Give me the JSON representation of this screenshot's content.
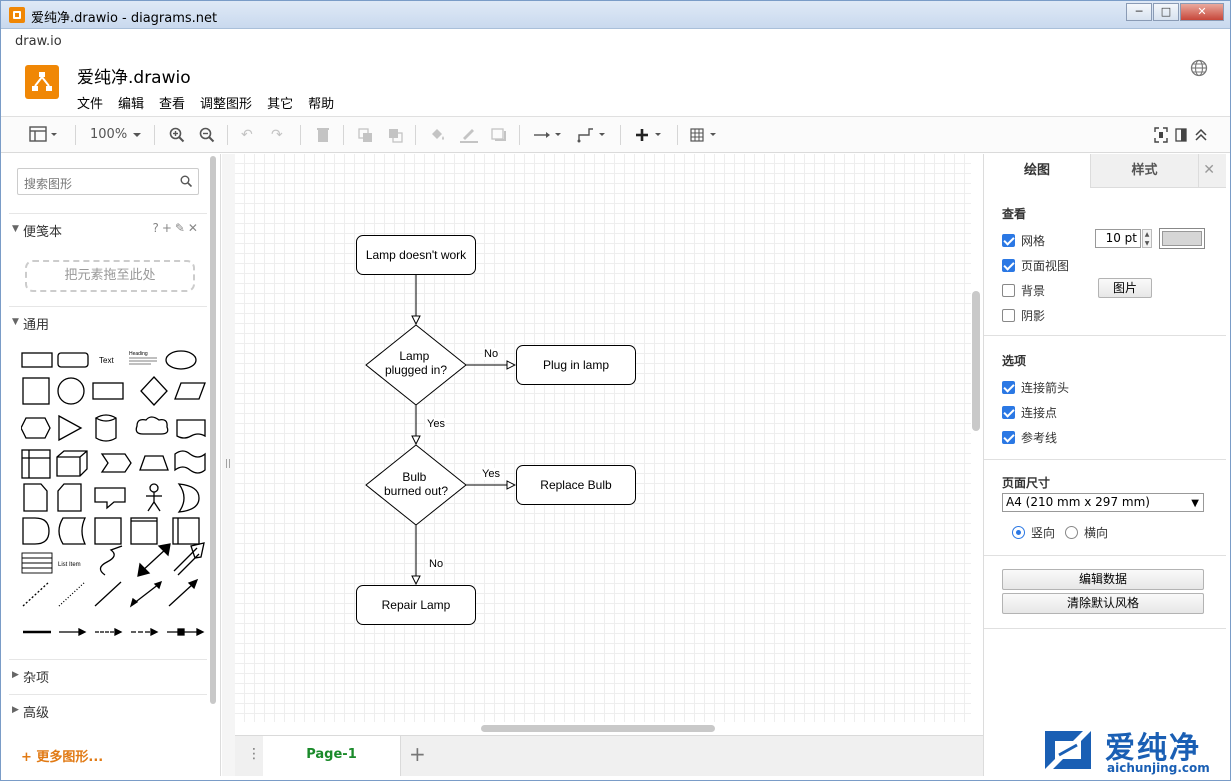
{
  "window": {
    "title": "爱纯净.drawio - diagrams.net",
    "minimize": "─",
    "maximize": "□",
    "close": "✕"
  },
  "app_bar": {
    "label": "draw.io"
  },
  "header": {
    "doc_title": "爱纯净.drawio",
    "menu": [
      "文件",
      "编辑",
      "查看",
      "调整图形",
      "其它",
      "帮助"
    ]
  },
  "toolbar": {
    "zoom": "100%"
  },
  "left_panel": {
    "search_placeholder": "搜索图形",
    "scratchpad_title": "便笺本",
    "scratchpad_tools": "?+✎✕",
    "dropzone": "把元素拖至此处",
    "general_title": "通用",
    "misc_title": "杂项",
    "advanced_title": "高级",
    "more_shapes": "更多图形...",
    "shape_labels": {
      "text": "Text",
      "heading": "Heading",
      "list_item": "List Item"
    }
  },
  "diagram": {
    "nodes": {
      "lamp_dont_work": "Lamp doesn't work",
      "plugged_line1": "Lamp",
      "plugged_line2": "plugged in?",
      "plug_in": "Plug in lamp",
      "bulb_line1": "Bulb",
      "bulb_line2": "burned out?",
      "replace": "Replace Bulb",
      "repair": "Repair Lamp"
    },
    "edge_labels": {
      "no1": "No",
      "yes1": "Yes",
      "yes2": "Yes",
      "no2": "No"
    }
  },
  "page_tabs": {
    "current": "Page-1",
    "add": "+"
  },
  "right_panel": {
    "tab_draw": "绘图",
    "tab_style": "样式",
    "view_section": "查看",
    "grid": "网格",
    "grid_size": "10 pt",
    "page_view": "页面视图",
    "background": "背景",
    "image_button": "图片",
    "shadow": "阴影",
    "options_section": "选项",
    "connection_arrows": "连接箭头",
    "connection_points": "连接点",
    "guides": "参考线",
    "paper_size_section": "页面尺寸",
    "paper_size": "A4 (210 mm x 297 mm)",
    "portrait": "竖向",
    "landscape": "横向",
    "edit_data": "编辑数据",
    "clear_default_style": "清除默认风格"
  },
  "watermark": {
    "big": "爱纯净",
    "small": "aichunjing.com"
  },
  "colors": {
    "accent_orange": "#f08705",
    "checkbox_blue": "#2b78e4",
    "page_tab_green": "#1a8a2a",
    "watermark_blue": "#1a5fb4"
  }
}
